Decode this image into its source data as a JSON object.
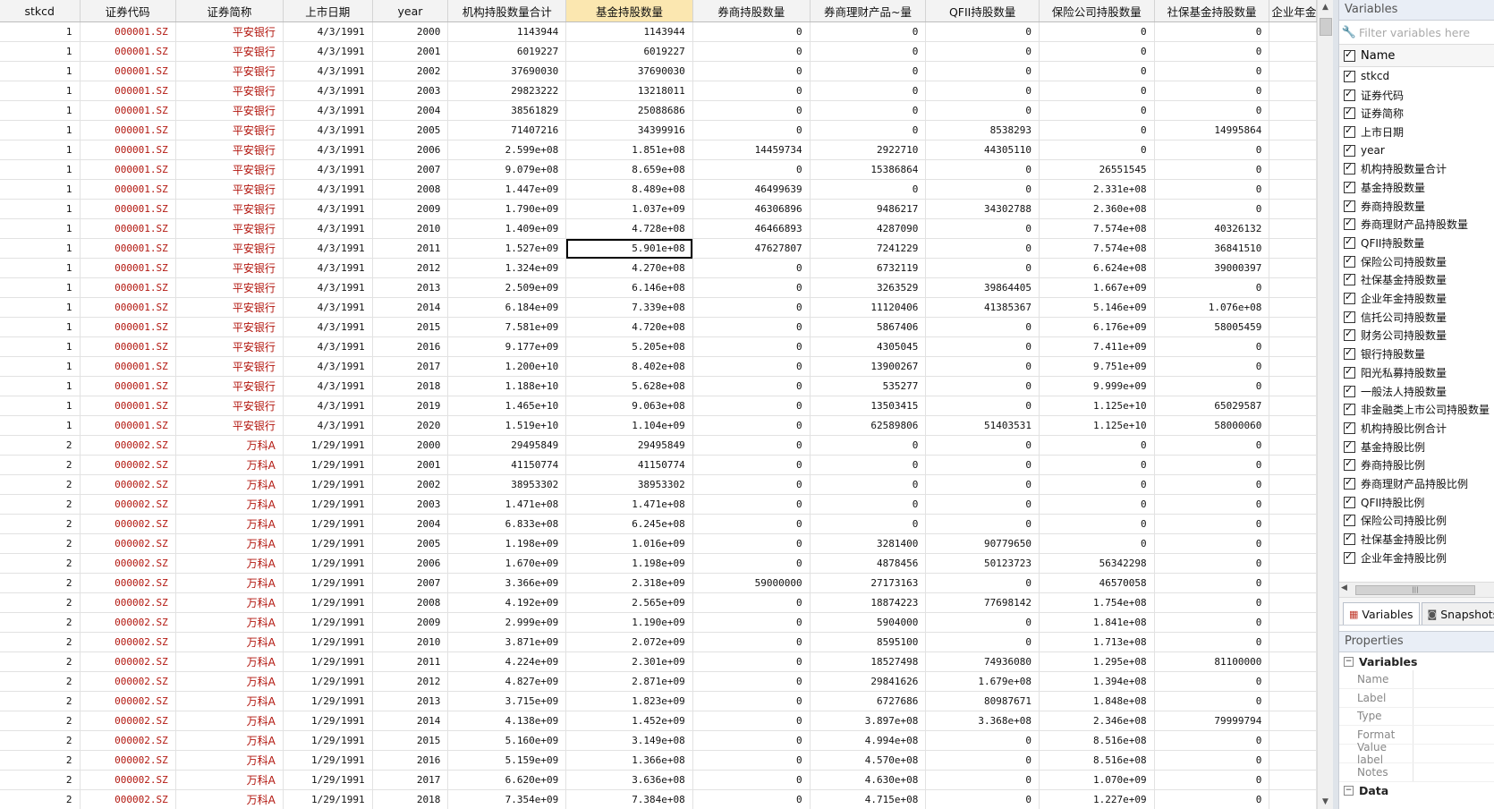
{
  "grid": {
    "headers": [
      "stkcd",
      "证券代码",
      "证券简称",
      "上市日期",
      "year",
      "机构持股数量合计",
      "基金持股数量",
      "券商持股数量",
      "券商理财产品~量",
      "QFII持股数量",
      "保险公司持股数量",
      "社保基金持股数量",
      "企业年金"
    ],
    "selected_column": 6,
    "current_cell": {
      "row": 11,
      "col": 6
    },
    "rows": [
      [
        "1",
        "000001.SZ",
        "平安银行",
        "4/3/1991",
        "2000",
        "1143944",
        "1143944",
        "0",
        "0",
        "0",
        "0",
        "0",
        ""
      ],
      [
        "1",
        "000001.SZ",
        "平安银行",
        "4/3/1991",
        "2001",
        "6019227",
        "6019227",
        "0",
        "0",
        "0",
        "0",
        "0",
        ""
      ],
      [
        "1",
        "000001.SZ",
        "平安银行",
        "4/3/1991",
        "2002",
        "37690030",
        "37690030",
        "0",
        "0",
        "0",
        "0",
        "0",
        ""
      ],
      [
        "1",
        "000001.SZ",
        "平安银行",
        "4/3/1991",
        "2003",
        "29823222",
        "13218011",
        "0",
        "0",
        "0",
        "0",
        "0",
        ""
      ],
      [
        "1",
        "000001.SZ",
        "平安银行",
        "4/3/1991",
        "2004",
        "38561829",
        "25088686",
        "0",
        "0",
        "0",
        "0",
        "0",
        ""
      ],
      [
        "1",
        "000001.SZ",
        "平安银行",
        "4/3/1991",
        "2005",
        "71407216",
        "34399916",
        "0",
        "0",
        "8538293",
        "0",
        "14995864",
        ""
      ],
      [
        "1",
        "000001.SZ",
        "平安银行",
        "4/3/1991",
        "2006",
        "2.599e+08",
        "1.851e+08",
        "14459734",
        "2922710",
        "44305110",
        "0",
        "0",
        ""
      ],
      [
        "1",
        "000001.SZ",
        "平安银行",
        "4/3/1991",
        "2007",
        "9.079e+08",
        "8.659e+08",
        "0",
        "15386864",
        "0",
        "26551545",
        "0",
        ""
      ],
      [
        "1",
        "000001.SZ",
        "平安银行",
        "4/3/1991",
        "2008",
        "1.447e+09",
        "8.489e+08",
        "46499639",
        "0",
        "0",
        "2.331e+08",
        "0",
        ""
      ],
      [
        "1",
        "000001.SZ",
        "平安银行",
        "4/3/1991",
        "2009",
        "1.790e+09",
        "1.037e+09",
        "46306896",
        "9486217",
        "34302788",
        "2.360e+08",
        "0",
        ""
      ],
      [
        "1",
        "000001.SZ",
        "平安银行",
        "4/3/1991",
        "2010",
        "1.409e+09",
        "4.728e+08",
        "46466893",
        "4287090",
        "0",
        "7.574e+08",
        "40326132",
        ""
      ],
      [
        "1",
        "000001.SZ",
        "平安银行",
        "4/3/1991",
        "2011",
        "1.527e+09",
        "5.901e+08",
        "47627807",
        "7241229",
        "0",
        "7.574e+08",
        "36841510",
        ""
      ],
      [
        "1",
        "000001.SZ",
        "平安银行",
        "4/3/1991",
        "2012",
        "1.324e+09",
        "4.270e+08",
        "0",
        "6732119",
        "0",
        "6.624e+08",
        "39000397",
        ""
      ],
      [
        "1",
        "000001.SZ",
        "平安银行",
        "4/3/1991",
        "2013",
        "2.509e+09",
        "6.146e+08",
        "0",
        "3263529",
        "39864405",
        "1.667e+09",
        "0",
        ""
      ],
      [
        "1",
        "000001.SZ",
        "平安银行",
        "4/3/1991",
        "2014",
        "6.184e+09",
        "7.339e+08",
        "0",
        "11120406",
        "41385367",
        "5.146e+09",
        "1.076e+08",
        ""
      ],
      [
        "1",
        "000001.SZ",
        "平安银行",
        "4/3/1991",
        "2015",
        "7.581e+09",
        "4.720e+08",
        "0",
        "5867406",
        "0",
        "6.176e+09",
        "58005459",
        ""
      ],
      [
        "1",
        "000001.SZ",
        "平安银行",
        "4/3/1991",
        "2016",
        "9.177e+09",
        "5.205e+08",
        "0",
        "4305045",
        "0",
        "7.411e+09",
        "0",
        ""
      ],
      [
        "1",
        "000001.SZ",
        "平安银行",
        "4/3/1991",
        "2017",
        "1.200e+10",
        "8.402e+08",
        "0",
        "13900267",
        "0",
        "9.751e+09",
        "0",
        ""
      ],
      [
        "1",
        "000001.SZ",
        "平安银行",
        "4/3/1991",
        "2018",
        "1.188e+10",
        "5.628e+08",
        "0",
        "535277",
        "0",
        "9.999e+09",
        "0",
        ""
      ],
      [
        "1",
        "000001.SZ",
        "平安银行",
        "4/3/1991",
        "2019",
        "1.465e+10",
        "9.063e+08",
        "0",
        "13503415",
        "0",
        "1.125e+10",
        "65029587",
        ""
      ],
      [
        "1",
        "000001.SZ",
        "平安银行",
        "4/3/1991",
        "2020",
        "1.519e+10",
        "1.104e+09",
        "0",
        "62589806",
        "51403531",
        "1.125e+10",
        "58000060",
        ""
      ],
      [
        "2",
        "000002.SZ",
        "万科A",
        "1/29/1991",
        "2000",
        "29495849",
        "29495849",
        "0",
        "0",
        "0",
        "0",
        "0",
        ""
      ],
      [
        "2",
        "000002.SZ",
        "万科A",
        "1/29/1991",
        "2001",
        "41150774",
        "41150774",
        "0",
        "0",
        "0",
        "0",
        "0",
        ""
      ],
      [
        "2",
        "000002.SZ",
        "万科A",
        "1/29/1991",
        "2002",
        "38953302",
        "38953302",
        "0",
        "0",
        "0",
        "0",
        "0",
        ""
      ],
      [
        "2",
        "000002.SZ",
        "万科A",
        "1/29/1991",
        "2003",
        "1.471e+08",
        "1.471e+08",
        "0",
        "0",
        "0",
        "0",
        "0",
        ""
      ],
      [
        "2",
        "000002.SZ",
        "万科A",
        "1/29/1991",
        "2004",
        "6.833e+08",
        "6.245e+08",
        "0",
        "0",
        "0",
        "0",
        "0",
        ""
      ],
      [
        "2",
        "000002.SZ",
        "万科A",
        "1/29/1991",
        "2005",
        "1.198e+09",
        "1.016e+09",
        "0",
        "3281400",
        "90779650",
        "0",
        "0",
        ""
      ],
      [
        "2",
        "000002.SZ",
        "万科A",
        "1/29/1991",
        "2006",
        "1.670e+09",
        "1.198e+09",
        "0",
        "4878456",
        "50123723",
        "56342298",
        "0",
        ""
      ],
      [
        "2",
        "000002.SZ",
        "万科A",
        "1/29/1991",
        "2007",
        "3.366e+09",
        "2.318e+09",
        "59000000",
        "27173163",
        "0",
        "46570058",
        "0",
        ""
      ],
      [
        "2",
        "000002.SZ",
        "万科A",
        "1/29/1991",
        "2008",
        "4.192e+09",
        "2.565e+09",
        "0",
        "18874223",
        "77698142",
        "1.754e+08",
        "0",
        ""
      ],
      [
        "2",
        "000002.SZ",
        "万科A",
        "1/29/1991",
        "2009",
        "2.999e+09",
        "1.190e+09",
        "0",
        "5904000",
        "0",
        "1.841e+08",
        "0",
        ""
      ],
      [
        "2",
        "000002.SZ",
        "万科A",
        "1/29/1991",
        "2010",
        "3.871e+09",
        "2.072e+09",
        "0",
        "8595100",
        "0",
        "1.713e+08",
        "0",
        ""
      ],
      [
        "2",
        "000002.SZ",
        "万科A",
        "1/29/1991",
        "2011",
        "4.224e+09",
        "2.301e+09",
        "0",
        "18527498",
        "74936080",
        "1.295e+08",
        "81100000",
        ""
      ],
      [
        "2",
        "000002.SZ",
        "万科A",
        "1/29/1991",
        "2012",
        "4.827e+09",
        "2.871e+09",
        "0",
        "29841626",
        "1.679e+08",
        "1.394e+08",
        "0",
        ""
      ],
      [
        "2",
        "000002.SZ",
        "万科A",
        "1/29/1991",
        "2013",
        "3.715e+09",
        "1.823e+09",
        "0",
        "6727686",
        "80987671",
        "1.848e+08",
        "0",
        ""
      ],
      [
        "2",
        "000002.SZ",
        "万科A",
        "1/29/1991",
        "2014",
        "4.138e+09",
        "1.452e+09",
        "0",
        "3.897e+08",
        "3.368e+08",
        "2.346e+08",
        "79999794",
        ""
      ],
      [
        "2",
        "000002.SZ",
        "万科A",
        "1/29/1991",
        "2015",
        "5.160e+09",
        "3.149e+08",
        "0",
        "4.994e+08",
        "0",
        "8.516e+08",
        "0",
        ""
      ],
      [
        "2",
        "000002.SZ",
        "万科A",
        "1/29/1991",
        "2016",
        "5.159e+09",
        "1.366e+08",
        "0",
        "4.570e+08",
        "0",
        "8.516e+08",
        "0",
        ""
      ],
      [
        "2",
        "000002.SZ",
        "万科A",
        "1/29/1991",
        "2017",
        "6.620e+09",
        "3.636e+08",
        "0",
        "4.630e+08",
        "0",
        "1.070e+09",
        "0",
        ""
      ],
      [
        "2",
        "000002.SZ",
        "万科A",
        "1/29/1991",
        "2018",
        "7.354e+09",
        "7.384e+08",
        "0",
        "4.715e+08",
        "0",
        "1.227e+09",
        "0",
        ""
      ]
    ]
  },
  "variables_panel": {
    "title": "Variables",
    "filter_placeholder": "Filter variables here",
    "name_header": "Name",
    "items": [
      "stkcd",
      "证券代码",
      "证券简称",
      "上市日期",
      "year",
      "机构持股数量合计",
      "基金持股数量",
      "券商持股数量",
      "券商理财产品持股数量",
      "QFII持股数量",
      "保险公司持股数量",
      "社保基金持股数量",
      "企业年金持股数量",
      "信托公司持股数量",
      "财务公司持股数量",
      "银行持股数量",
      "阳光私募持股数量",
      "一般法人持股数量",
      "非金融类上市公司持股数量",
      "机构持股比例合计",
      "基金持股比例",
      "券商持股比例",
      "券商理财产品持股比例",
      "QFII持股比例",
      "保险公司持股比例",
      "社保基金持股比例",
      "企业年金持股比例"
    ],
    "tabs": [
      "Variables",
      "Snapshots"
    ]
  },
  "properties_panel": {
    "title": "Properties",
    "group_variables": "Variables",
    "fields": [
      "Name",
      "Label",
      "Type",
      "Format",
      "Value label",
      "Notes"
    ],
    "group_data": "Data"
  },
  "colors": {
    "string_text": "#b2160e",
    "selected_header": "#fbe7b0",
    "panel_header": "#e9eef6"
  }
}
